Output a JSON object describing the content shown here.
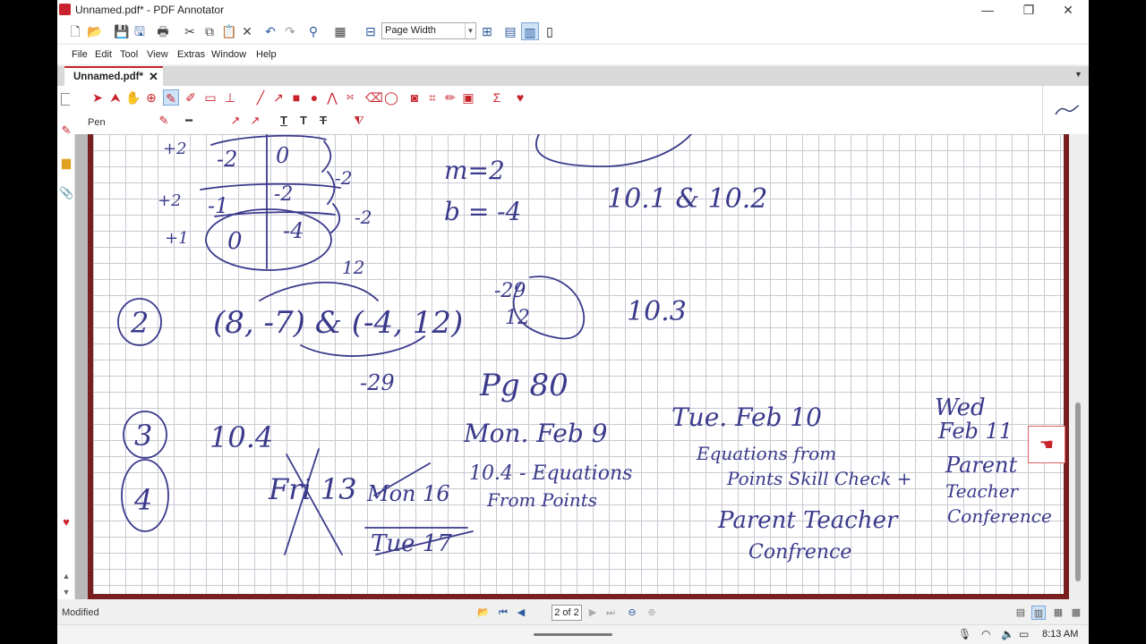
{
  "window": {
    "title": "Unnamed.pdf* - PDF Annotator",
    "min": "—",
    "max": "❐",
    "close": "✕"
  },
  "toolbar": {
    "zoom_value": "Page Width"
  },
  "menu": [
    "File",
    "Edit",
    "Tool",
    "View",
    "Extras",
    "Window",
    "Help"
  ],
  "tab": {
    "label": "Unnamed.pdf*",
    "close": "✕"
  },
  "ribbon": {
    "tool_label": "Pen"
  },
  "status": {
    "modified": "Modified",
    "page": "2 of 2"
  },
  "taskbar": {
    "time": "8:13 AM"
  },
  "handwriting": {
    "top_left_cells": [
      "-2",
      "0",
      "-1",
      "-2",
      "0",
      "-4"
    ],
    "top_left_row_labels": [
      "+2",
      "+2",
      "+1"
    ],
    "top_left_side_labels": [
      "-2",
      "-2"
    ],
    "m": "m=2",
    "b": "b = -4",
    "lessons_1": "10.1 & 10.2",
    "n2": "2",
    "points": "(8, -7) & (-4, 12)",
    "rise": "12",
    "run": "-29",
    "slope_num": "-29",
    "slope_den": "12",
    "lesson_3": "10.3",
    "page_ref": "Pg 80",
    "n3": "3",
    "lesson_4": "10.4",
    "n4": "4",
    "fri": "Fri 13",
    "mon16": "Mon 16",
    "tue17": "Tue 17",
    "mon_title": "Mon. Feb 9",
    "mon_l1": "10.4 - Equations",
    "mon_l2": "From Points",
    "tue_title": "Tue. Feb 10",
    "tue_l1": "Equations from",
    "tue_l2": "Points Skill Check +",
    "tue_l3": "Parent Teacher",
    "tue_l4": "Confrence",
    "wed_1": "Wed",
    "wed_2": "Feb 11",
    "wed_3": "Parent",
    "wed_4": "Teacher",
    "wed_5": "Conference"
  },
  "colors": {
    "accent": "#c8232c",
    "ink": "#3a3a8c",
    "frame": "#7a1f1f"
  }
}
